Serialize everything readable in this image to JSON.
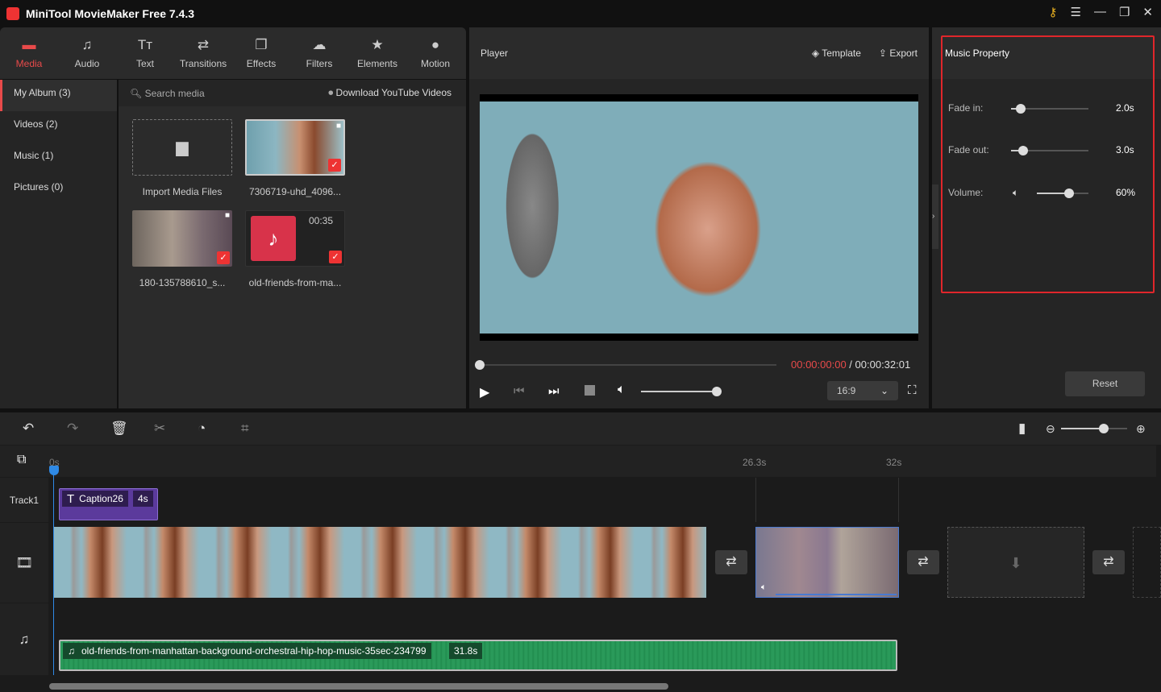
{
  "app": {
    "title": "MiniTool MovieMaker Free 7.4.3",
    "window_buttons": [
      "key-icon",
      "menu-icon",
      "minimize-icon",
      "maximize-icon",
      "close-icon"
    ]
  },
  "toolbar": {
    "items": [
      {
        "label": "Media",
        "icon": "folder-icon",
        "active": true
      },
      {
        "label": "Audio",
        "icon": "music-note-icon"
      },
      {
        "label": "Text",
        "icon": "text-icon"
      },
      {
        "label": "Transitions",
        "icon": "swap-arrows-icon"
      },
      {
        "label": "Effects",
        "icon": "effects-icon"
      },
      {
        "label": "Filters",
        "icon": "filters-icon"
      },
      {
        "label": "Elements",
        "icon": "elements-icon"
      },
      {
        "label": "Motion",
        "icon": "motion-icon"
      }
    ]
  },
  "sidebar": {
    "items": [
      {
        "label": "My Album (3)",
        "active": true
      },
      {
        "label": "Videos (2)"
      },
      {
        "label": "Music (1)"
      },
      {
        "label": "Pictures (0)"
      }
    ]
  },
  "media": {
    "search_placeholder": "Search media",
    "download_label": "Download YouTube Videos",
    "items": [
      {
        "label": "Import Media Files"
      },
      {
        "label": "7306719-uhd_4096..."
      },
      {
        "label": "180-135788610_s..."
      },
      {
        "label": "old-friends-from-ma...",
        "duration": "00:35"
      }
    ]
  },
  "player": {
    "title": "Player",
    "template_label": "Template",
    "export_label": "Export",
    "current_time": "00:00:00:00",
    "separator": " / ",
    "total_time": "00:00:32:01",
    "aspect_ratio": "16:9",
    "progress_percent": 0,
    "volume_percent": 100
  },
  "property": {
    "title": "Music Property",
    "fade_in_label": "Fade in:",
    "fade_in_value": "2.0s",
    "fade_out_label": "Fade out:",
    "fade_out_value": "3.0s",
    "volume_label": "Volume:",
    "volume_value": "60%",
    "reset_label": "Reset",
    "accent": "#e0262b"
  },
  "timeline": {
    "ruler": [
      "0s",
      "26.3s",
      "32s"
    ],
    "track1_label": "Track1",
    "caption": {
      "name": "Caption26",
      "duration": "4s"
    },
    "audio": {
      "name": "old-friends-from-manhattan-background-orchestral-hip-hop-music-35sec-234799",
      "duration": "31.8s"
    },
    "zoom_percent": 80
  }
}
